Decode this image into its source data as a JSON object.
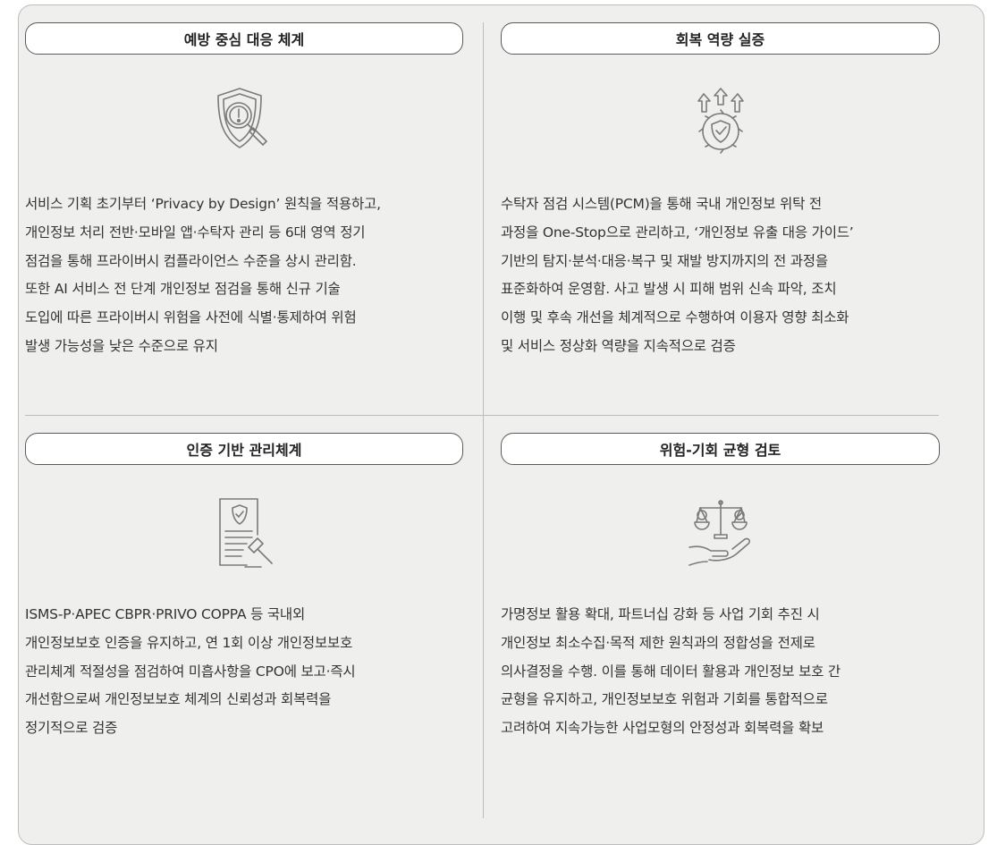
{
  "sections": [
    {
      "title": "예방 중심 대응 체계",
      "icon": "shield-search-icon",
      "text": "서비스 기획 초기부터 ‘Privacy by Design’ 원칙을 적용하고,\n개인정보 처리 전반·모바일 앱·수탁자 관리 등 6대 영역 정기\n점검을 통해 프라이버시 컴플라이언스 수준을 상시 관리함.\n또한 AI 서비스 전 단계 개인정보 점검을 통해 신규 기술\n도입에 따른 프라이버시 위험을 사전에 식별·통제하여 위험\n발생 가능성을 낮은 수준으로 유지"
    },
    {
      "title": "회복 역량 실증",
      "icon": "gear-shield-arrows-icon",
      "text": "수탁자 점검 시스템(PCM)을 통해 국내 개인정보 위탁 전\n과정을 One-Stop으로 관리하고, ‘개인정보 유출 대응 가이드’\n기반의 탐지·분석·대응·복구 및 재발 방지까지의 전 과정을\n표준화하여 운영함. 사고 발생 시 피해 범위 신속 파악, 조치\n이행 및 후속 개선을 체계적으로 수행하여 이용자 영향 최소화\n및 서비스 정상화 역량을 지속적으로 검증"
    },
    {
      "title": "인증 기반 관리체계",
      "icon": "certificate-gavel-icon",
      "text": "ISMS-P·APEC CBPR·PRIVO COPPA 등 국내외\n개인정보보호 인증을 유지하고, 연 1회 이상 개인정보보호\n관리체계 적절성을 점검하여 미흡사항을 CPO에 보고·즉시\n개선함으로써 개인정보보호 체계의 신뢰성과 회복력을\n정기적으로 검증"
    },
    {
      "title": "위험-기회 균형 검토",
      "icon": "balance-scale-hand-icon",
      "text": "가명정보 활용 확대, 파트너십 강화 등 사업 기회 추진 시\n개인정보 최소수집·목적 제한 원칙과의 정합성을 전제로\n의사결정을 수행. 이를 통해 데이터 활용과 개인정보 보호 간\n균형을 유지하고, 개인정보보호 위험과 기회를 통합적으로\n고려하여 지속가능한 사업모형의 안정성과 회복력을 확보"
    }
  ]
}
